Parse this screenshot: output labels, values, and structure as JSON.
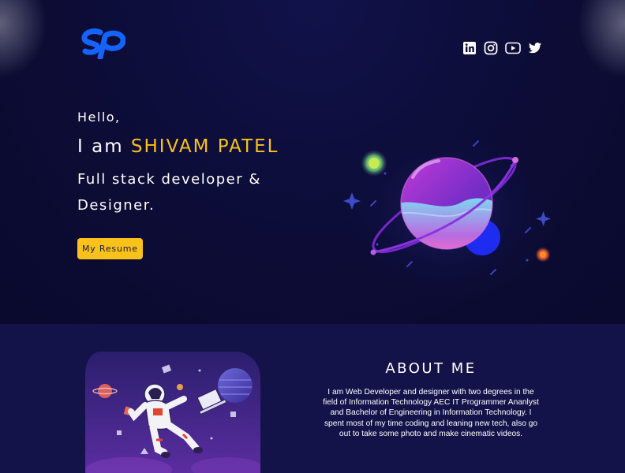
{
  "header": {
    "logo_alt": "sp",
    "social": [
      {
        "icon": "linkedin-icon"
      },
      {
        "icon": "instagram-icon"
      },
      {
        "icon": "youtube-icon"
      },
      {
        "icon": "twitter-icon"
      }
    ]
  },
  "hero": {
    "greeting": "Hello,",
    "intro_prefix": "I am ",
    "name": "SHIVAM PATEL",
    "role": "Full stack developer & Designer.",
    "resume_button": "My Resume"
  },
  "about": {
    "title": "ABOUT ME",
    "text": "I am Web Developer and designer with two degrees in the field of Information Technology AEC  IT Programmer Ananlyst and Bachelor of Engineering in Information Technology. I spent most of my time coding and leaning new tech, also go out to take some photo and make cinematic videos."
  },
  "colors": {
    "accent": "#f9c21a",
    "hero_bg": "#0c0c36",
    "about_bg": "#13134a",
    "logo": "#1463ff"
  }
}
